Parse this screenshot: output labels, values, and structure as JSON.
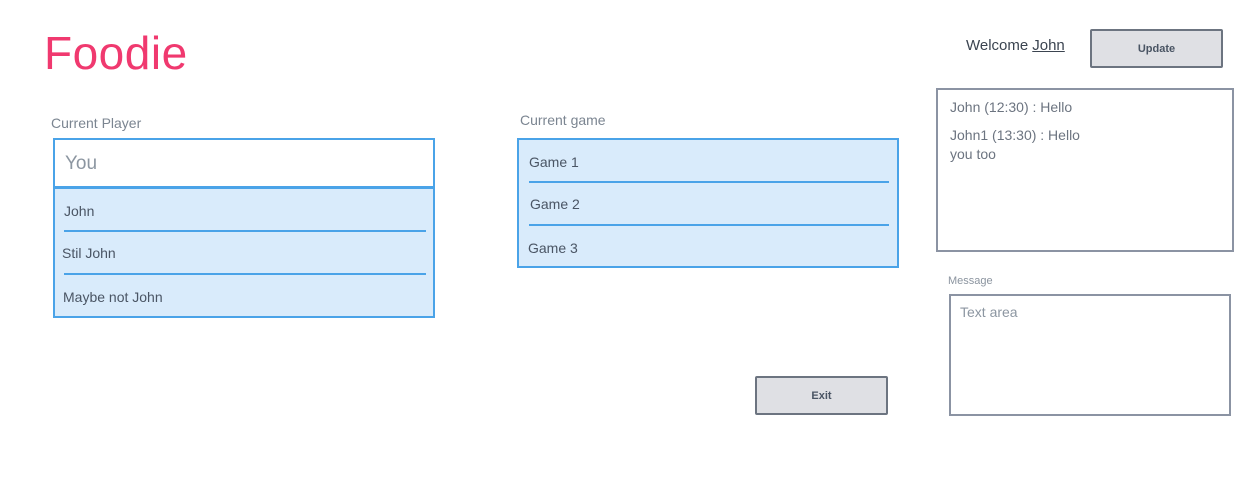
{
  "app": {
    "logo": "Foodie"
  },
  "header": {
    "welcome_text": "Welcome",
    "username": "John",
    "update_label": "Update"
  },
  "player": {
    "label": "Current Player",
    "input_value": "You",
    "items": [
      {
        "label": "John"
      },
      {
        "label": "Stil John"
      },
      {
        "label": "Maybe not John"
      }
    ]
  },
  "game": {
    "label": "Current game",
    "items": [
      {
        "label": "Game 1"
      },
      {
        "label": "Game 2"
      },
      {
        "label": "Game 3"
      }
    ]
  },
  "chat": {
    "messages": [
      {
        "text": "John (12:30) : Hello"
      },
      {
        "text": "John1 (13:30) : Hello you too"
      }
    ],
    "message_label": "Message",
    "textarea_placeholder": "Text area"
  },
  "footer": {
    "exit_label": "Exit"
  },
  "colors": {
    "brand": "#f0396f",
    "list_bg": "#d9ebfb",
    "list_border": "#4aa3e8",
    "button_bg": "#dfe0e4"
  }
}
